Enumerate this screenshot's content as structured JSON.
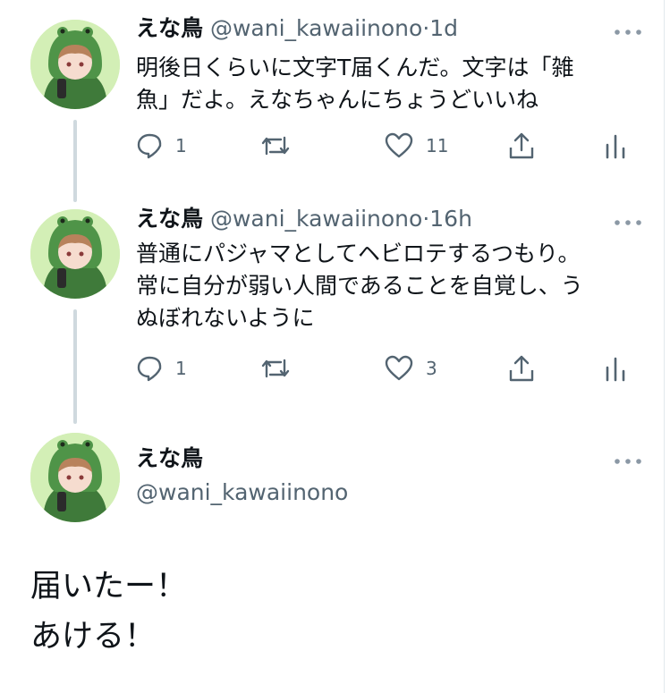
{
  "colors": {
    "text": "#0f1419",
    "secondary": "#536471",
    "thread_line": "#cfd9de",
    "avatar_bg": "#d3efb6"
  },
  "tweets": [
    {
      "name": "えな鳥",
      "handle": "@wani_kawaiinono",
      "separator": "·",
      "time": "1d",
      "lines": [
        "明後日くらいに文字T届くんだ。文字は「雑",
        "魚」だよ。えなちゃんにちょうどいいね"
      ],
      "replies": "1",
      "retweets": "",
      "likes": "11"
    },
    {
      "name": "えな鳥",
      "handle": "@wani_kawaiinono",
      "separator": "·",
      "time": "16h",
      "lines": [
        "普通にパジャマとしてヘビロテするつもり。",
        "常に自分が弱い人間であることを自覚し、う",
        "ぬぼれないように"
      ],
      "replies": "1",
      "retweets": "",
      "likes": "3"
    }
  ],
  "main_tweet": {
    "name": "えな鳥",
    "handle": "@wani_kawaiinono",
    "lines": [
      "届いたー！",
      "あける！"
    ]
  },
  "icons": [
    "more-icon",
    "reply-icon",
    "retweet-icon",
    "like-icon",
    "share-icon",
    "analytics-icon",
    "avatar"
  ]
}
